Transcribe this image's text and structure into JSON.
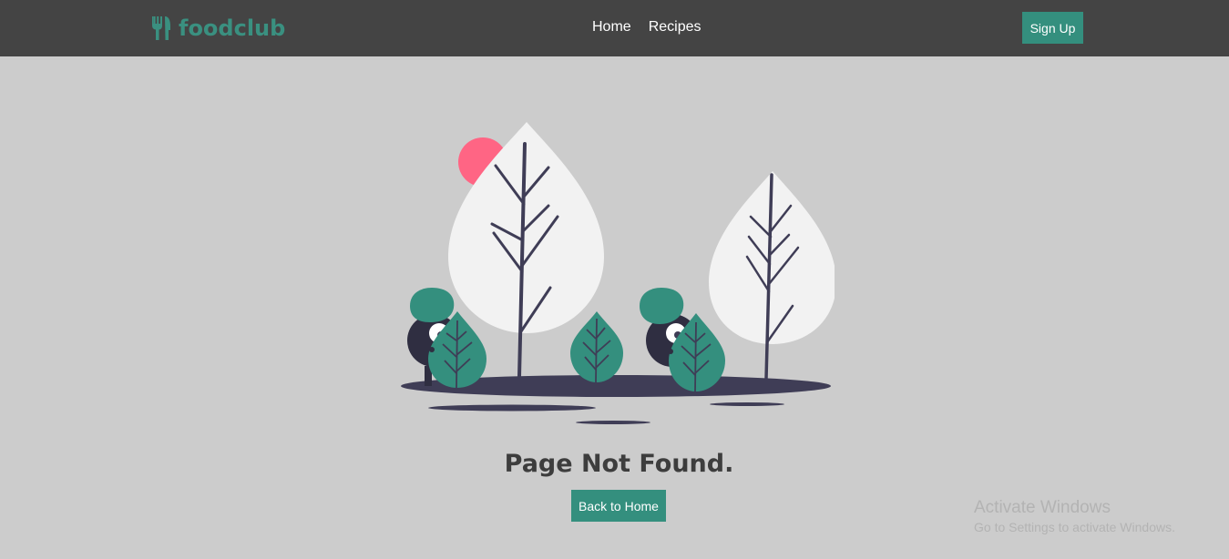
{
  "navbar": {
    "brand": {
      "name": "foodclub",
      "icon": "fork-knife-icon",
      "color": "#3a9080"
    },
    "links": [
      {
        "label": "Home"
      },
      {
        "label": "Recipes"
      }
    ],
    "signup_label": "Sign Up",
    "background": "#444444"
  },
  "main": {
    "illustration": "page-not-found-illustration",
    "title": "Page Not Found.",
    "back_label": "Back to Home",
    "accent": "#348f7e",
    "background": "#cccccc"
  },
  "watermark": {
    "title": "Activate Windows",
    "subtitle": "Go to Settings to activate Windows."
  }
}
